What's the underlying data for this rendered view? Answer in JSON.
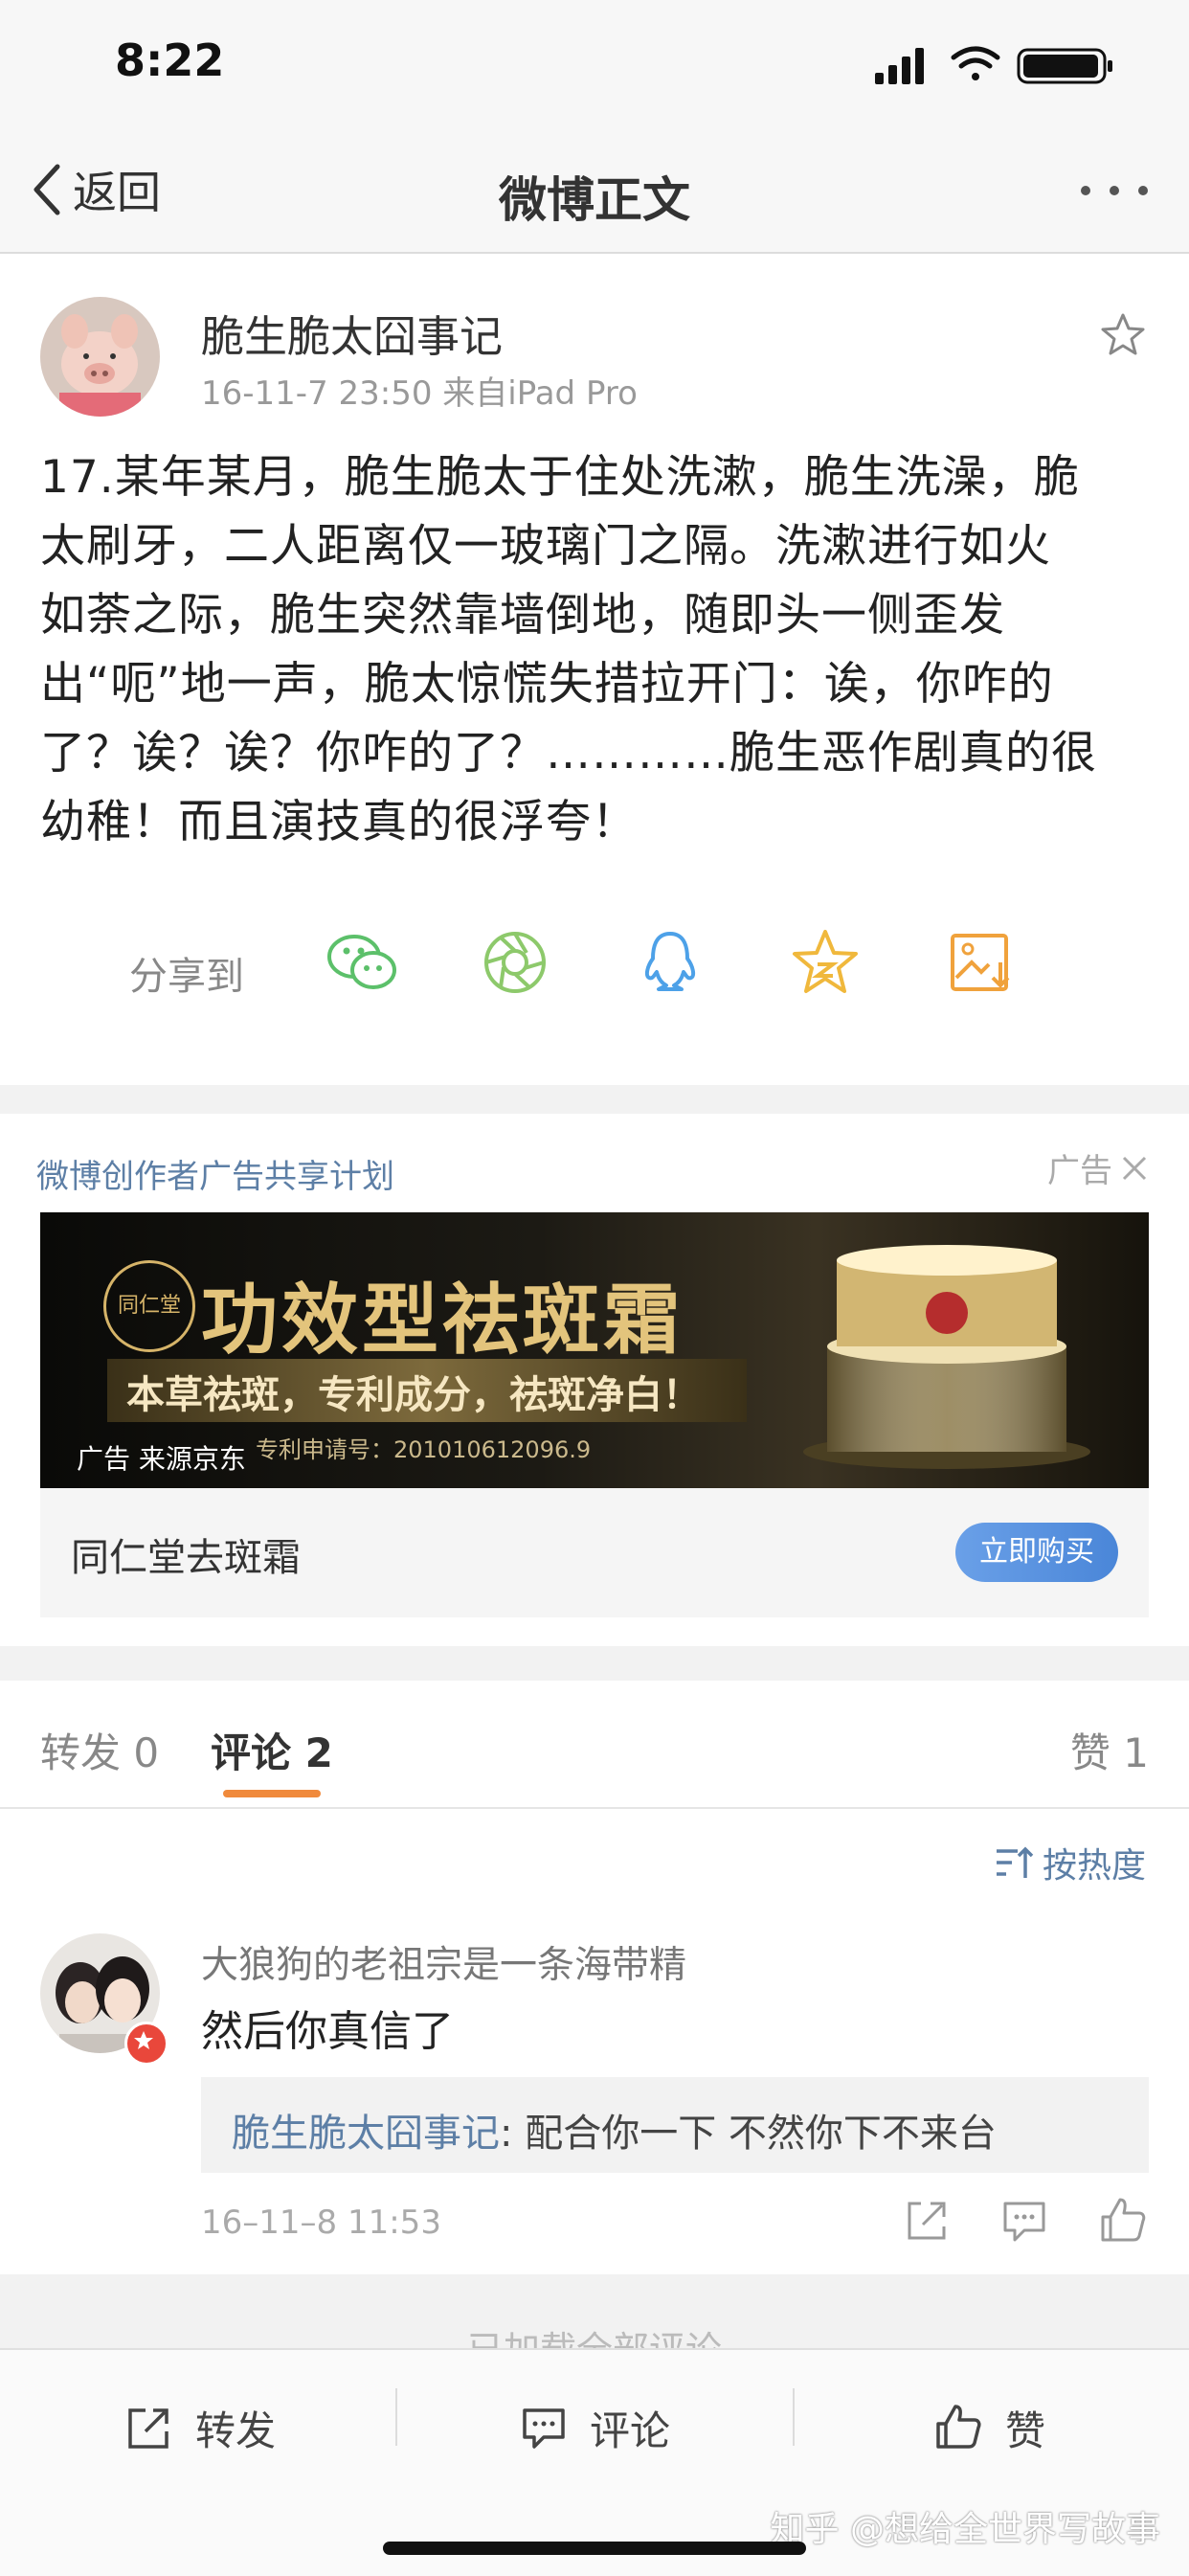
{
  "status_bar": {
    "time": "8:22"
  },
  "nav": {
    "back_label": "返回",
    "title": "微博正文"
  },
  "post": {
    "author": "脆生脆太囧事记",
    "meta": "16-11-7 23:50  来自iPad Pro",
    "lines": [
      "17.某年某月，脆生脆太于住处洗漱，脆生洗澡，脆",
      "太刷牙，二人距离仅一玻璃门之隔。洗漱进行如火",
      "如荼之际，脆生突然靠墙倒地，随即头一侧歪发",
      "出“呃”地一声，脆太惊慌失措拉开门：诶，你咋的",
      "了？诶？诶？你咋的了？…………脆生恶作剧真的很",
      "幼稚！而且演技真的很浮夸！"
    ],
    "share_label": "分享到",
    "share_icons": [
      "wechat-icon",
      "moments-icon",
      "qq-icon",
      "favorite-star-icon",
      "save-image-icon"
    ],
    "share_colors": {
      "wechat": "#5cc06a",
      "moments": "#8dc96b",
      "qq": "#4da1e8",
      "star": "#f0b83c",
      "save": "#f0a23c"
    }
  },
  "ad": {
    "program": "微博创作者广告共享计划",
    "tag": "广告",
    "banner_headline": "功效型祛斑霜",
    "banner_slogan": "本草祛斑，专利成分，祛斑净白！",
    "banner_patent": "专利申请号：201010612096.9",
    "banner_source": "广告 来源京东",
    "seal_text": "同仁堂",
    "product": "同仁堂去斑霜",
    "buy_label": "立即购买"
  },
  "tabs": {
    "repost": "转发 0",
    "comment": "评论 2",
    "like": "赞 1",
    "accent": "#f08a3c"
  },
  "comments": {
    "sort_label": "按热度",
    "items": [
      {
        "user": "大狼狗的老祖宗是一条海带精",
        "text": "然后你真信了",
        "reply_author": "脆生脆太囧事记",
        "reply_text": ": 配合你一下 不然你下不来台",
        "time": "16–11–8 11:53"
      }
    ],
    "loaded": "已加载全部评论"
  },
  "toolbar": {
    "repost": "转发",
    "comment": "评论",
    "like": "赞"
  },
  "watermark": "知乎 @想给全世界写故事"
}
